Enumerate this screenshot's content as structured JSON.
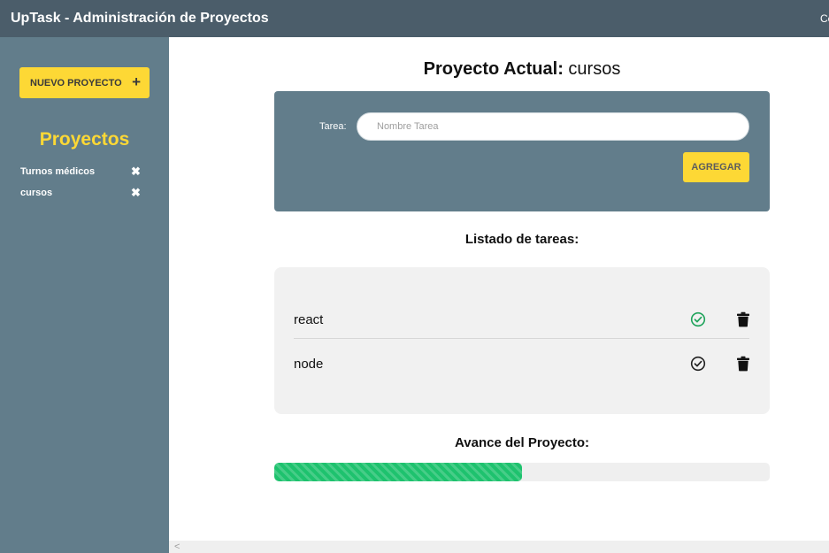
{
  "header": {
    "title": "UpTask - Administración de Proyectos",
    "right_text": "Ce"
  },
  "sidebar": {
    "new_project_label": "NUEVO PROYECTO",
    "new_project_icon": "+",
    "title": "Proyectos",
    "projects": [
      {
        "name": "Turnos médicos",
        "delete_icon": "✖"
      },
      {
        "name": "cursos",
        "delete_icon": "✖"
      }
    ]
  },
  "main": {
    "title_prefix": "Proyecto Actual:",
    "title_project": "cursos",
    "form": {
      "task_label": "Tarea:",
      "task_placeholder": "Nombre Tarea",
      "task_value": "",
      "submit_label": "AGREGAR"
    },
    "list_heading": "Listado de tareas:",
    "tasks": [
      {
        "name": "react",
        "completed": true,
        "check_icon": "check-circle-icon",
        "delete_icon": "trash-icon"
      },
      {
        "name": "node",
        "completed": false,
        "check_icon": "check-circle-icon",
        "delete_icon": "trash-icon"
      }
    ],
    "progress_heading": "Avance del Proyecto:",
    "progress_percent": 50
  },
  "colors": {
    "header_bg": "#4b5d6a",
    "sidebar_bg": "#627d8b",
    "accent_yellow": "#fdd835",
    "progress_green": "#1ec26e",
    "check_done": "#1ea35a",
    "check_pending": "#222222"
  },
  "scrollbar": {
    "left_arrow": "<"
  }
}
